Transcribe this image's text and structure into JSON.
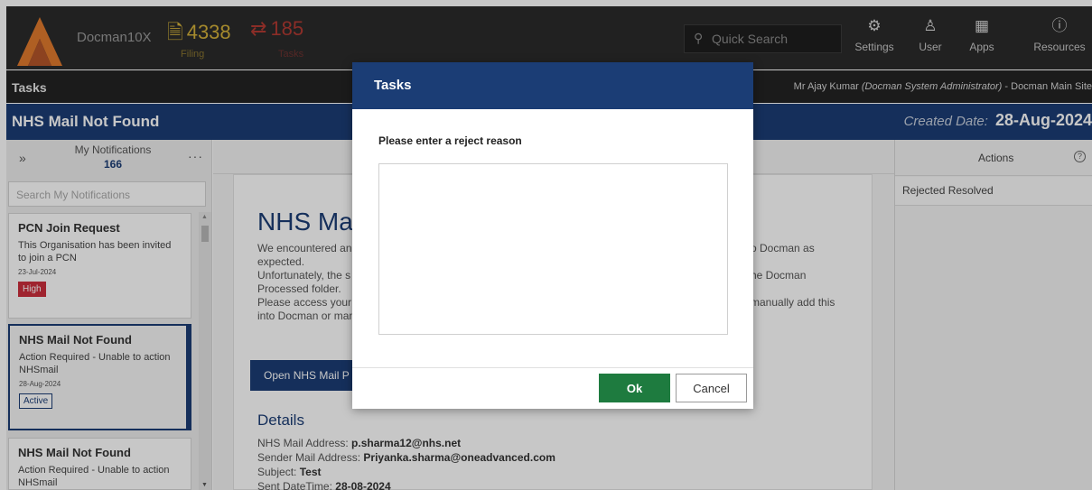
{
  "app": {
    "name": "Docman10X",
    "filing_count": "4338",
    "filing_label": "Filing",
    "tasks_count": "185",
    "tasks_label": "Tasks"
  },
  "search": {
    "placeholder": "Quick Search"
  },
  "nav": [
    {
      "label": "Settings",
      "icon": "gear-icon"
    },
    {
      "label": "User",
      "icon": "user-icon"
    },
    {
      "label": "Apps",
      "icon": "grid-icon"
    },
    {
      "label": "Resources",
      "icon": "info-icon"
    }
  ],
  "bar2": {
    "title": "Tasks",
    "user_name": "Mr Ajay Kumar",
    "user_role": "(Docman System Administrator)",
    "user_site": " - Docman Main Site"
  },
  "page": {
    "title": "NHS Mail Not Found",
    "created_label": "Created Date:",
    "created_value": "28-Aug-2024"
  },
  "notifications": {
    "label": "My Notifications",
    "count": "166",
    "search_placeholder": "Search My Notifications",
    "items": [
      {
        "title": "PCN Join Request",
        "desc": "This Organisation has been invited to join a PCN",
        "date": "23-Jul-2024",
        "badge": "High"
      },
      {
        "title": "NHS Mail Not Found",
        "desc": "Action Required - Unable to action NHSmail",
        "date": "28-Aug-2024",
        "badge": "Active"
      },
      {
        "title": "NHS Mail Not Found",
        "desc": "Action Required - Unable to action NHSmail",
        "date": "",
        "badge": ""
      }
    ]
  },
  "main": {
    "heading": "NHS Mai",
    "para_left": [
      "We encountered an",
      "expected.",
      "Unfortunately, the s",
      "Processed folder.",
      "Please access your",
      "into Docman or man"
    ],
    "para_right": [
      "o Docman as",
      "",
      "he Docman",
      "",
      "manually add this",
      ""
    ],
    "open_button": "Open NHS Mail P",
    "details_heading": "Details",
    "details": [
      {
        "label": "NHS Mail Address: ",
        "value": "p.sharma12@nhs.net"
      },
      {
        "label": "Sender Mail Address: ",
        "value": "Priyanka.sharma@oneadvanced.com"
      },
      {
        "label": "Subject: ",
        "value": "Test"
      },
      {
        "label": "Sent DateTime: ",
        "value": "28-08-2024"
      }
    ]
  },
  "actions": {
    "label": "Actions",
    "status": "Rejected Resolved"
  },
  "modal": {
    "title": "Tasks",
    "prompt": "Please enter a reject reason",
    "reason_value": "",
    "ok_label": "Ok",
    "cancel_label": "Cancel"
  }
}
